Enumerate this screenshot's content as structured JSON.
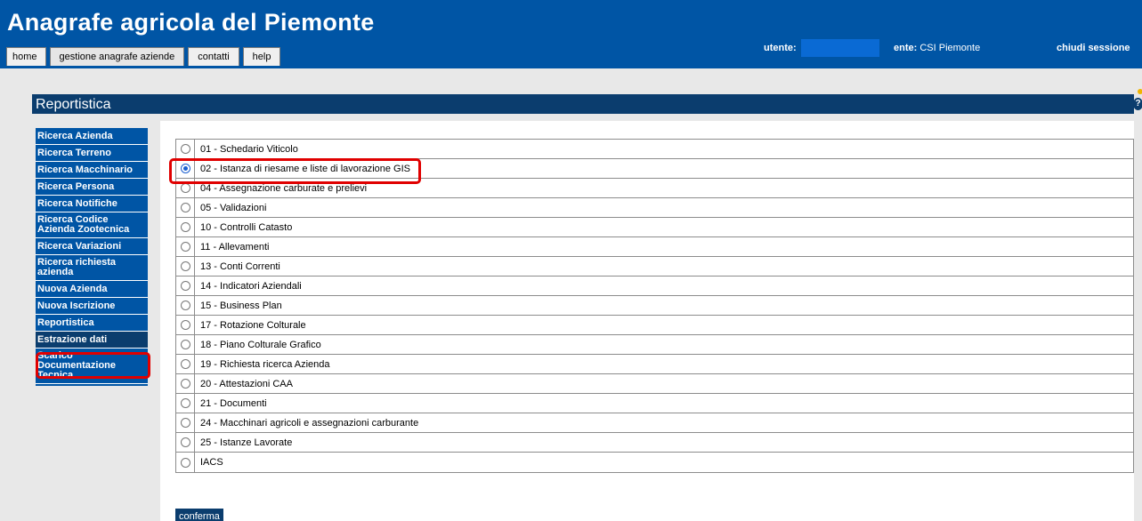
{
  "header": {
    "title": "Anagrafe agricola del Piemonte",
    "tabs": [
      "home",
      "gestione anagrafe aziende",
      "contatti",
      "help"
    ],
    "user_label": "utente:",
    "ente_label": "ente:",
    "ente_value": "CSI Piemonte",
    "logout": "chiudi sessione"
  },
  "section": {
    "title": "Reportistica",
    "help_icon": "help-icon"
  },
  "sidebar": {
    "items": [
      "Ricerca Azienda",
      "Ricerca Terreno",
      "Ricerca Macchinario",
      "Ricerca Persona",
      "Ricerca Notifiche",
      "Ricerca Codice Azienda Zootecnica",
      "Ricerca Variazioni",
      "Ricerca richiesta azienda",
      "Nuova Azienda",
      "Nuova Iscrizione",
      "Reportistica",
      "Estrazione dati",
      "Scarico Documentazione Tecnica"
    ],
    "active_index": 11
  },
  "report_options": [
    {
      "label": "01 - Schedario Viticolo",
      "checked": false
    },
    {
      "label": "02 - Istanza di riesame e liste di lavorazione GIS",
      "checked": true
    },
    {
      "label": "04 - Assegnazione carburate e prelievi",
      "checked": false
    },
    {
      "label": "05 - Validazioni",
      "checked": false
    },
    {
      "label": "10 - Controlli Catasto",
      "checked": false
    },
    {
      "label": "11 - Allevamenti",
      "checked": false
    },
    {
      "label": "13 - Conti Correnti",
      "checked": false
    },
    {
      "label": "14 - Indicatori Aziendali",
      "checked": false
    },
    {
      "label": "15 - Business Plan",
      "checked": false
    },
    {
      "label": "17 - Rotazione Colturale",
      "checked": false
    },
    {
      "label": "18 - Piano Colturale Grafico",
      "checked": false
    },
    {
      "label": "19 - Richiesta ricerca Azienda",
      "checked": false
    },
    {
      "label": "20 - Attestazioni CAA",
      "checked": false
    },
    {
      "label": "21 - Documenti",
      "checked": false
    },
    {
      "label": "24 - Macchinari agricoli e assegnazioni carburante",
      "checked": false
    },
    {
      "label": "25 - Istanze Lavorate",
      "checked": false
    },
    {
      "label": "IACS",
      "checked": false
    }
  ],
  "confirm_label": "conferma",
  "colors": {
    "brand": "#0055a5",
    "dark": "#0b3d6e",
    "highlight": "#e00000"
  }
}
